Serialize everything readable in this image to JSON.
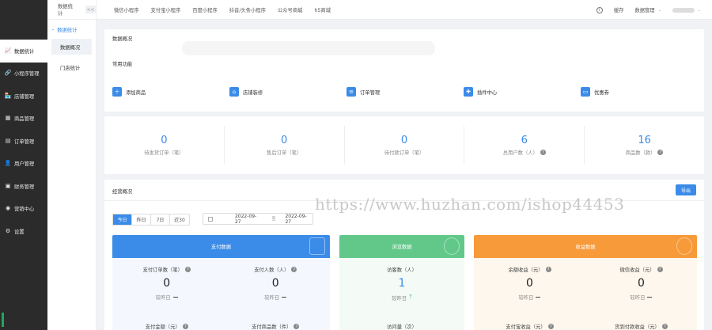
{
  "sidebar": {
    "items": [
      {
        "label": "数据统计",
        "icon": "chart-icon",
        "glyph": "📈"
      },
      {
        "label": "小程序管理",
        "icon": "link-icon",
        "glyph": "🔗"
      },
      {
        "label": "店铺管理",
        "icon": "store-icon",
        "glyph": "🏪"
      },
      {
        "label": "商品管理",
        "icon": "goods-icon",
        "glyph": "▦"
      },
      {
        "label": "订单管理",
        "icon": "order-icon",
        "glyph": "▤"
      },
      {
        "label": "用户管理",
        "icon": "user-icon",
        "glyph": "👤"
      },
      {
        "label": "财务管理",
        "icon": "finance-icon",
        "glyph": "▣"
      },
      {
        "label": "营销中心",
        "icon": "marketing-icon",
        "glyph": "◉"
      },
      {
        "label": "设置",
        "icon": "settings-icon",
        "glyph": "⚙"
      }
    ]
  },
  "subside": {
    "header": "数据统计",
    "collapse": "<<",
    "group": "数据统计",
    "items": [
      "数据概况",
      "门店统计"
    ]
  },
  "topbar": {
    "tabs": [
      "微信小程序",
      "支付宝小程序",
      "百度小程序",
      "抖音/头条小程序",
      "公众号商城",
      "h5商城"
    ],
    "clear_cache": "缓存",
    "admin": "数据管理"
  },
  "overview": {
    "title": "数据概况",
    "common_title": "常用功能",
    "functions": [
      {
        "label": "添加商品",
        "icon": "add-goods-icon",
        "glyph": "＋"
      },
      {
        "label": "店铺装修",
        "icon": "shop-decor-icon",
        "glyph": "⌂"
      },
      {
        "label": "订单管理",
        "icon": "order-manage-icon",
        "glyph": "≡"
      },
      {
        "label": "插件中心",
        "icon": "plugin-icon",
        "glyph": "✚"
      },
      {
        "label": "优惠券",
        "icon": "coupon-icon",
        "glyph": "▭"
      }
    ]
  },
  "stats": [
    {
      "value": "0",
      "label": "待发货订单（笔）",
      "help": false
    },
    {
      "value": "0",
      "label": "售后订单（笔）",
      "help": false
    },
    {
      "value": "0",
      "label": "待付款订单（笔）",
      "help": false
    },
    {
      "value": "6",
      "label": "总用户数（人）",
      "help": true
    },
    {
      "value": "16",
      "label": "商品数（款）",
      "help": true
    }
  ],
  "business": {
    "title": "经营概况",
    "export": "导出",
    "ranges": [
      "今日",
      "昨日",
      "7日",
      "近30"
    ],
    "date_start": "2022-09-27",
    "date_sep": "至",
    "date_end": "2022-09-27"
  },
  "panels": {
    "pay": {
      "title": "支付数据",
      "metrics": [
        {
          "label": "支付订单数（笔）",
          "value": "0",
          "compare": "较昨日"
        },
        {
          "label": "支付人数（人）",
          "value": "0",
          "compare": "较昨日"
        }
      ],
      "more": [
        "支付金额（元）",
        "支付商品数（件）"
      ]
    },
    "visit": {
      "title": "浏览数据",
      "metric": {
        "label": "访客数（人）",
        "value": "1",
        "compare": "较昨日"
      },
      "more": "访问量（次）"
    },
    "income": {
      "title": "收益数据",
      "metrics": [
        {
          "label": "余额收益（元）",
          "value": "0",
          "compare": "较昨日"
        },
        {
          "label": "微信收益（元）",
          "value": "0",
          "compare": "较昨日"
        }
      ],
      "more": [
        "支付宝收益（元）",
        "货到付款收益（元）"
      ]
    }
  },
  "watermark": "https://www.huzhan.com/ishop44453"
}
